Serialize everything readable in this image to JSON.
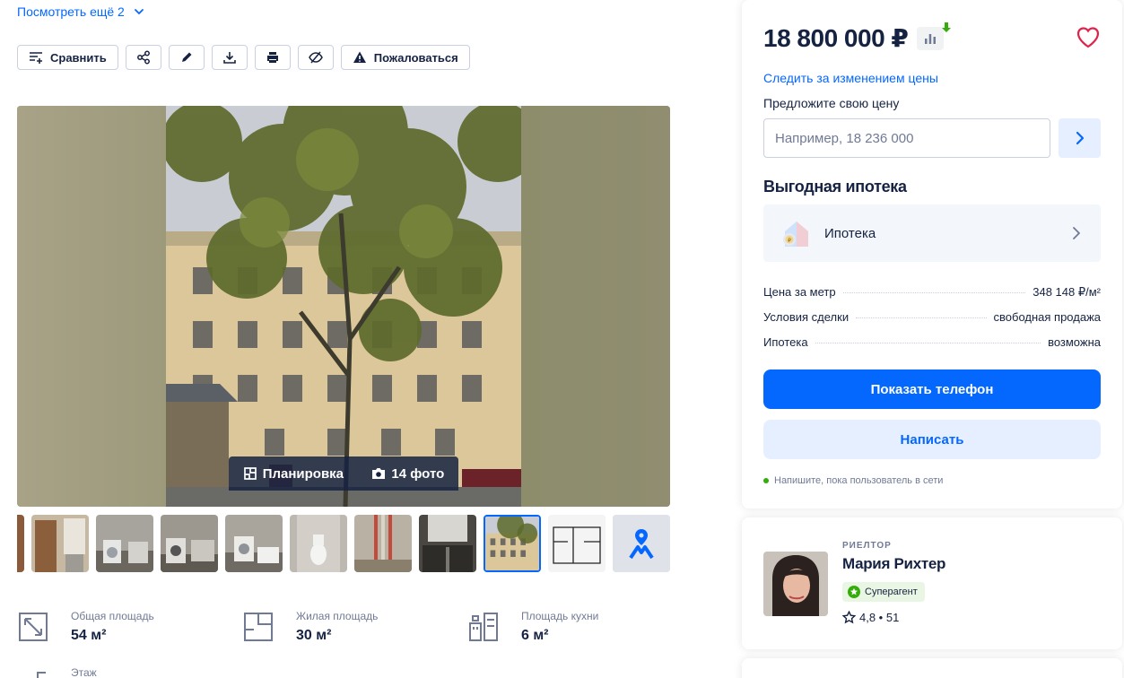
{
  "header": {
    "more_link": "Посмотреть ещё 2"
  },
  "toolbar": {
    "compare_label": "Сравнить",
    "report_label": "Пожаловаться"
  },
  "gallery": {
    "layout_label": "Планировка",
    "photos_label": "14 фото"
  },
  "features": [
    {
      "label": "Общая площадь",
      "value": "54 м²",
      "icon": "total-area-icon"
    },
    {
      "label": "Жилая площадь",
      "value": "30 м²",
      "icon": "living-area-icon"
    },
    {
      "label": "Площадь кухни",
      "value": "6 м²",
      "icon": "kitchen-area-icon"
    },
    {
      "label": "Этаж",
      "value": "",
      "icon": "floor-icon"
    }
  ],
  "sidebar": {
    "price": "18 800 000 ₽",
    "follow_price": "Следить за изменением цены",
    "offer_label": "Предложите свою цену",
    "offer_placeholder": "Например, 18 236 000",
    "mortgage_title": "Выгодная ипотека",
    "mortgage_item": "Ипотека",
    "facts": [
      {
        "label": "Цена за метр",
        "value": "348 148 ₽/м²"
      },
      {
        "label": "Условия сделки",
        "value": "свободная продажа"
      },
      {
        "label": "Ипотека",
        "value": "возможна"
      }
    ],
    "show_phone": "Показать телефон",
    "write": "Написать",
    "online_note": "Напишите, пока пользователь в сети"
  },
  "agent": {
    "role": "РИЕЛТОР",
    "name": "Мария Рихтер",
    "badge": "Суперагент",
    "rating": "4,8 • 51"
  },
  "colors": {
    "accent": "#0468ff",
    "accent_light": "#e6efff",
    "text": "#152242",
    "muted": "#707a95",
    "favorite": "#e1234b",
    "price_drop": "#34ac0a"
  }
}
